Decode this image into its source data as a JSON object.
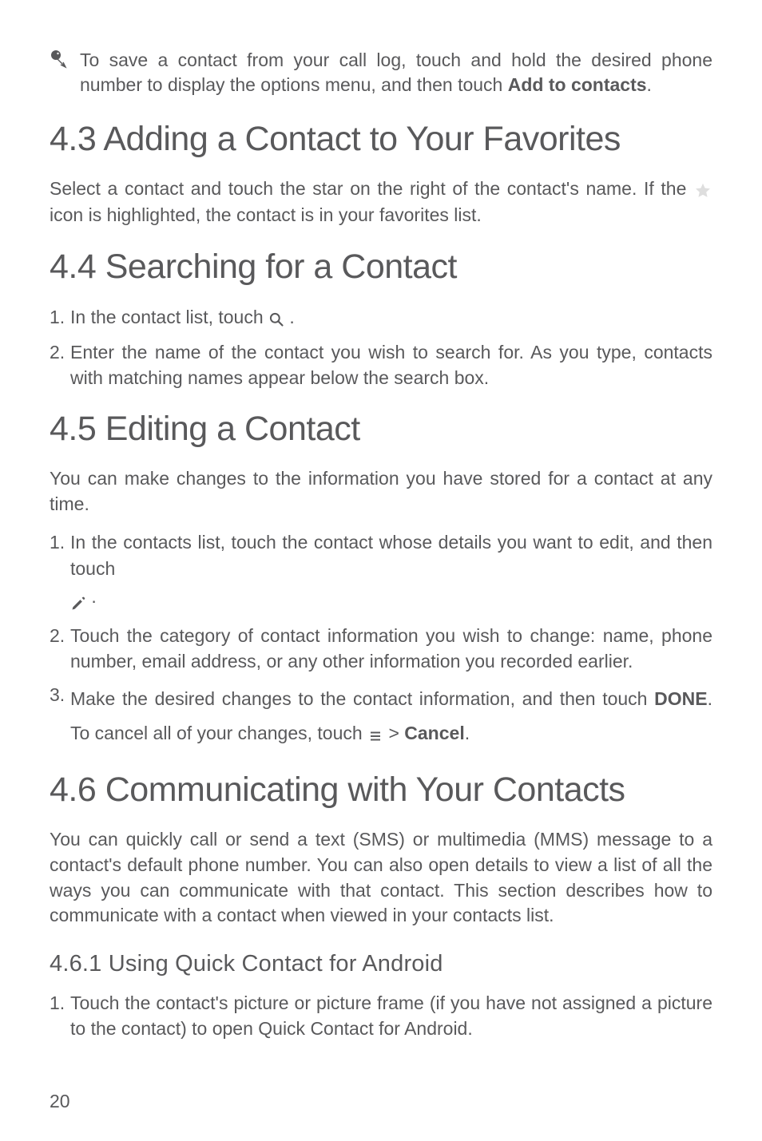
{
  "tip": {
    "part1": "To save a contact from your call log, touch and hold the desired phone number to display the options menu, and then touch ",
    "bold": "Add to contacts",
    "part2": "."
  },
  "s43": {
    "heading": "4.3  Adding a Contact to Your Favorites",
    "p1a": "Select a contact and touch the star on the right of the contact's name. If the ",
    "p1b": " icon is highlighted, the contact is in your favorites list."
  },
  "s44": {
    "heading": "4.4  Searching for a Contact",
    "li1a": "In the contact list, touch ",
    "li1b": " .",
    "li2": "Enter the name of the contact you wish to search for. As you type, contacts with matching names appear below the search box."
  },
  "s45": {
    "heading": "4.5  Editing a Contact",
    "p1": "You can make changes to the information you have stored for a contact at any time.",
    "li1a": "In the contacts list, touch the contact whose details you want to edit, and then touch ",
    "li1b": " .",
    "li2": "Touch the category of contact information you wish to change: name, phone number, email address, or any other information you recorded earlier.",
    "li3a": "Make the desired changes to the contact information, and then touch ",
    "li3bold1": "DONE",
    "li3b": ". To cancel all of your changes, touch ",
    "li3c": "  > ",
    "li3bold2": "Cancel",
    "li3d": "."
  },
  "s46": {
    "heading": "4.6  Communicating with Your Contacts",
    "p1": "You can quickly call or send a text (SMS) or multimedia (MMS) message to a contact's default phone number. You can also open details to view a list of all the ways you can communicate with that contact. This section describes how to communicate with a contact when viewed in your contacts list.",
    "sub": "4.6.1   Using Quick Contact for Android",
    "li1": "Touch the contact's picture or picture frame (if you have not assigned a picture to the contact) to open Quick Contact for Android."
  },
  "pagenum": "20"
}
